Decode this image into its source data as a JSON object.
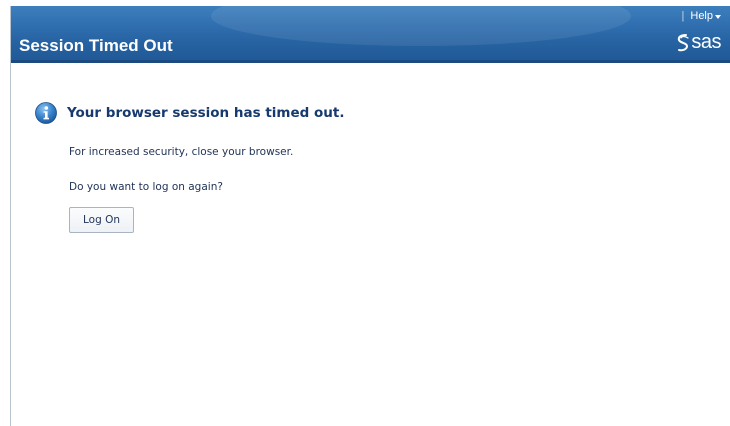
{
  "header": {
    "title": "Session Timed Out",
    "help_label": "Help",
    "logo_text": "sas"
  },
  "message": {
    "icon": "info-icon",
    "heading": "Your browser session has timed out.",
    "security_note": "For increased security, close your browser.",
    "question": "Do you want to log on again?"
  },
  "actions": {
    "logon_label": "Log On"
  },
  "colors": {
    "header_bg": "#2f6eaf",
    "heading_text": "#173a6e",
    "body_text": "#1f3256"
  }
}
